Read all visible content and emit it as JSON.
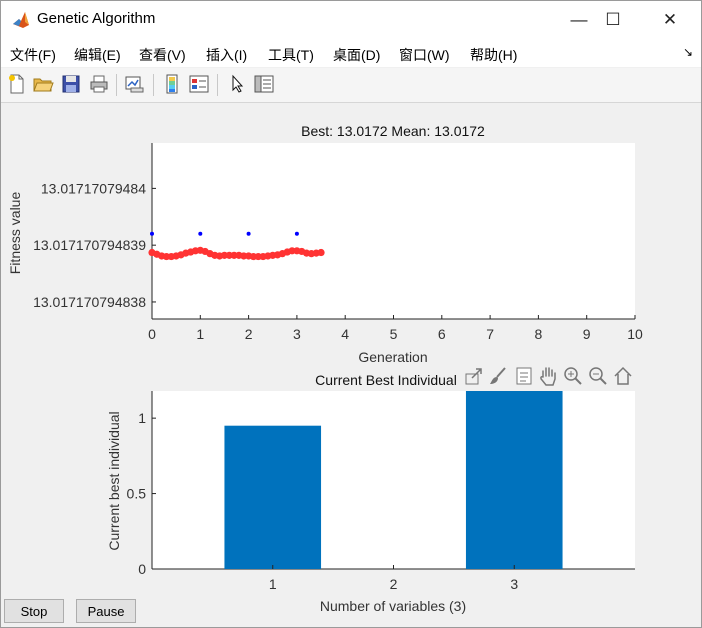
{
  "window": {
    "title": "Genetic Algorithm",
    "minimize_glyph": "—",
    "maximize_glyph": "☐",
    "close_glyph": "✕"
  },
  "menu": {
    "items": [
      "文件(F)",
      "编辑(E)",
      "查看(V)",
      "插入(I)",
      "工具(T)",
      "桌面(D)",
      "窗口(W)",
      "帮助(H)"
    ],
    "overflow_glyph": "↘"
  },
  "toolbar": {
    "icons": [
      "new-figure-icon",
      "open-file-icon",
      "save-icon",
      "print-icon",
      "link-plot-icon",
      "colorbar-icon",
      "legend-icon",
      "pointer-icon",
      "property-inspector-icon"
    ]
  },
  "axes_toolbar": {
    "icons": [
      "export-icon",
      "brush-icon",
      "datatip-icon",
      "pan-hand-icon",
      "zoom-in-icon",
      "zoom-out-icon",
      "home-icon"
    ]
  },
  "colors": {
    "best_points": "#0000ff",
    "mean_points": "#ff3333",
    "bars": "#0072bd"
  },
  "chart_data": [
    {
      "type": "scatter",
      "title": "Best: 13.0172 Mean: 13.0172",
      "xlabel": "Generation",
      "ylabel": "Fitness value",
      "xlim": [
        0,
        10
      ],
      "xticks": [
        "0",
        "1",
        "2",
        "3",
        "4",
        "5",
        "6",
        "7",
        "8",
        "9",
        "10"
      ],
      "yticks": [
        "13.01717079484",
        "13.017170794839",
        "13.017170794838"
      ],
      "y_axis_note": "tick labels shown top to bottom",
      "series": [
        {
          "name": "",
          "color": "#0000ff",
          "marker": "dot",
          "x": [
            0,
            1,
            2,
            3
          ],
          "y": [
            13.0171707948392,
            13.0171707948392,
            13.0171707948392,
            13.0171707948392
          ]
        },
        {
          "name": "",
          "color": "#ff3333",
          "marker": "dot",
          "x": [
            0,
            0.1,
            0.2,
            0.3,
            0.4,
            0.5,
            0.6,
            0.7,
            0.8,
            0.9,
            1.0,
            1.1,
            1.2,
            1.3,
            1.4,
            1.5,
            1.6,
            1.7,
            1.8,
            1.9,
            2.0,
            2.1,
            2.2,
            2.3,
            2.4,
            2.5,
            2.6,
            2.7,
            2.8,
            2.9,
            3.0,
            3.1,
            3.2,
            3.3,
            3.4,
            3.5
          ],
          "y": [
            13.01717079483887,
            13.01717079483884,
            13.01717079483881,
            13.0171707948388,
            13.0171707948388,
            13.01717079483881,
            13.01717079483883,
            13.01717079483886,
            13.01717079483888,
            13.0171707948389,
            13.01717079483891,
            13.01717079483889,
            13.01717079483885,
            13.01717079483882,
            13.01717079483881,
            13.01717079483882,
            13.01717079483882,
            13.01717079483882,
            13.01717079483882,
            13.01717079483881,
            13.01717079483881,
            13.0171707948388,
            13.0171707948388,
            13.0171707948388,
            13.01717079483881,
            13.01717079483882,
            13.01717079483883,
            13.01717079483885,
            13.01717079483888,
            13.0171707948389,
            13.0171707948389,
            13.01717079483889,
            13.01717079483886,
            13.01717079483885,
            13.01717079483886,
            13.01717079483887
          ]
        }
      ]
    },
    {
      "type": "bar",
      "title": "Current Best Individual",
      "xlabel": "Number of variables (3)",
      "ylabel": "Current best individual",
      "categories": [
        "1",
        "2",
        "3"
      ],
      "values": [
        0.95,
        0.0,
        1.25
      ],
      "ylim": [
        0,
        1.18
      ],
      "yticks": [
        "0",
        "0.5",
        "1"
      ],
      "color": "#0072bd"
    }
  ],
  "buttons": {
    "stop_label": "Stop",
    "pause_label": "Pause"
  }
}
